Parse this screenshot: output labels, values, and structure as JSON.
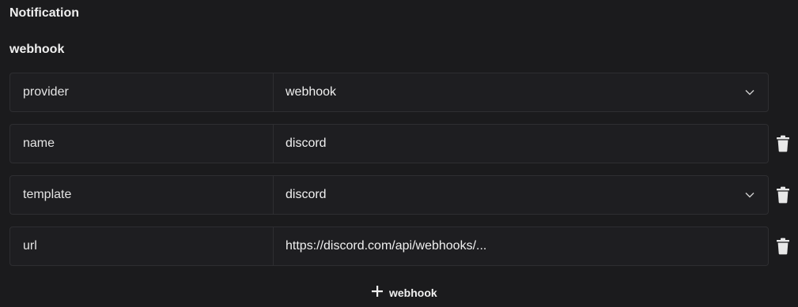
{
  "section_title": "Notification",
  "group_title": "webhook",
  "rows": [
    {
      "key": "provider",
      "value": "webhook",
      "type": "select",
      "deletable": false
    },
    {
      "key": "name",
      "value": "discord",
      "type": "text",
      "deletable": true
    },
    {
      "key": "template",
      "value": "discord",
      "type": "select",
      "deletable": true
    },
    {
      "key": "url",
      "value": "https://discord.com/api/webhooks/...",
      "type": "text",
      "deletable": true
    }
  ],
  "add_button_label": "webhook",
  "icons": {
    "chevron": "chevron-down-icon",
    "delete": "trash-icon",
    "add": "plus-icon"
  }
}
